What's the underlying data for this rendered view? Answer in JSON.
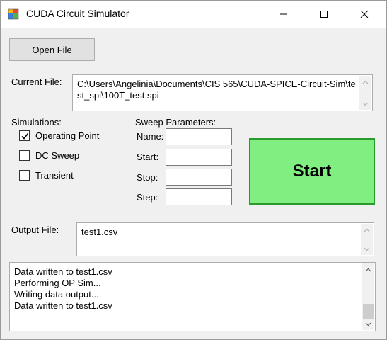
{
  "window": {
    "title": "CUDA Circuit Simulator"
  },
  "titlebar": {
    "minimize_icon": "minimize-icon",
    "maximize_icon": "maximize-icon",
    "close_icon": "close-icon"
  },
  "open_file": {
    "label": "Open File"
  },
  "current_file": {
    "label": "Current File:",
    "value": "C:\\Users\\Angelinia\\Documents\\CIS 565\\CUDA-SPICE-Circuit-Sim\\test_spi\\100T_test.spi"
  },
  "simulations": {
    "label": "Simulations:",
    "options": [
      {
        "label": "Operating Point",
        "checked": true
      },
      {
        "label": "DC Sweep",
        "checked": false
      },
      {
        "label": "Transient",
        "checked": false
      }
    ]
  },
  "sweep": {
    "label": "Sweep Parameters:",
    "fields": [
      {
        "label": "Name:",
        "value": ""
      },
      {
        "label": "Start:",
        "value": ""
      },
      {
        "label": "Stop:",
        "value": ""
      },
      {
        "label": "Step:",
        "value": ""
      }
    ]
  },
  "start": {
    "label": "Start",
    "color": "#80ee80"
  },
  "output_file": {
    "label": "Output File:",
    "value": "test1.csv"
  },
  "log": {
    "lines": [
      "Data written to test1.csv",
      "Performing OP Sim...",
      "Writing data output...",
      "Data written to test1.csv"
    ]
  }
}
